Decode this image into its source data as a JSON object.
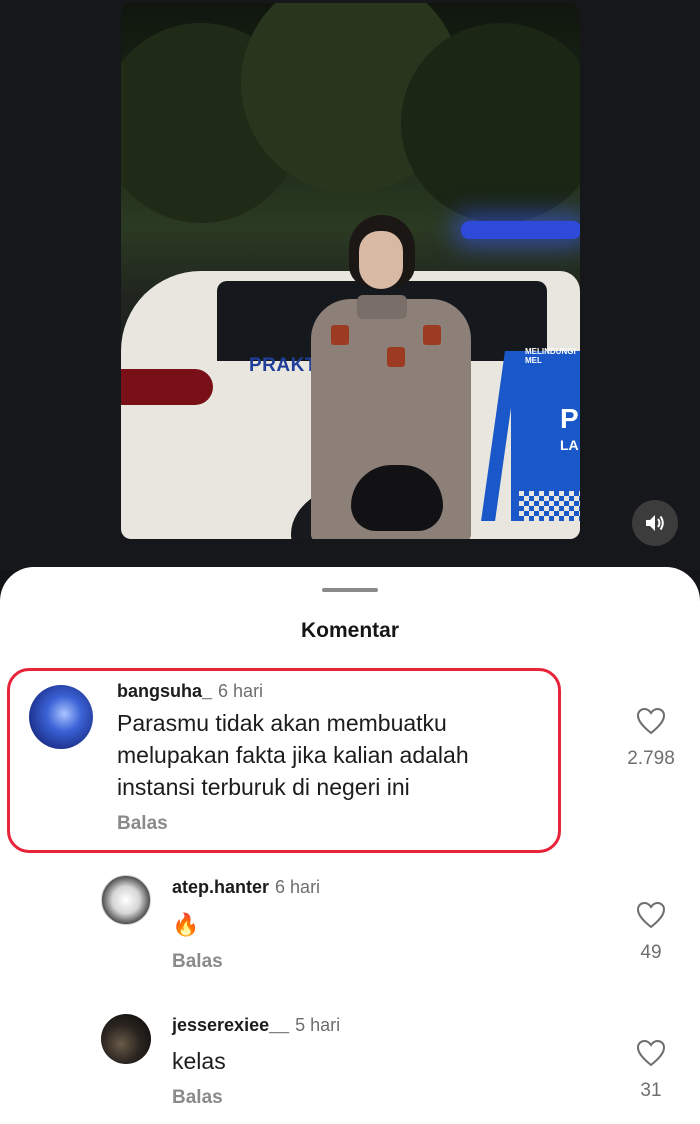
{
  "video": {
    "car_text": "PRAKTEK",
    "car_text_side": "P",
    "car_text_side2": "LA",
    "car_small_text": "MELINDUNGI MEL",
    "sound_icon": "speaker-icon"
  },
  "sheet": {
    "title": "Komentar"
  },
  "comments": [
    {
      "user": "bangsuha_",
      "time": "6 hari",
      "text_lines": [
        "Parasmu tidak akan membuatku",
        "melupakan fakta jika kalian adalah",
        "instansi terburuk di negeri ini"
      ],
      "reply": "Balas",
      "likes": "2.798"
    },
    {
      "user": "atep.hanter",
      "time": "6 hari",
      "text": "🔥",
      "reply": "Balas",
      "likes": "49"
    },
    {
      "user": "jesserexiee__",
      "time": "5 hari",
      "text": "kelas",
      "reply": "Balas",
      "likes": "31"
    }
  ],
  "colors": {
    "highlight": "#e8243a",
    "police_blue": "#1a57c9"
  }
}
